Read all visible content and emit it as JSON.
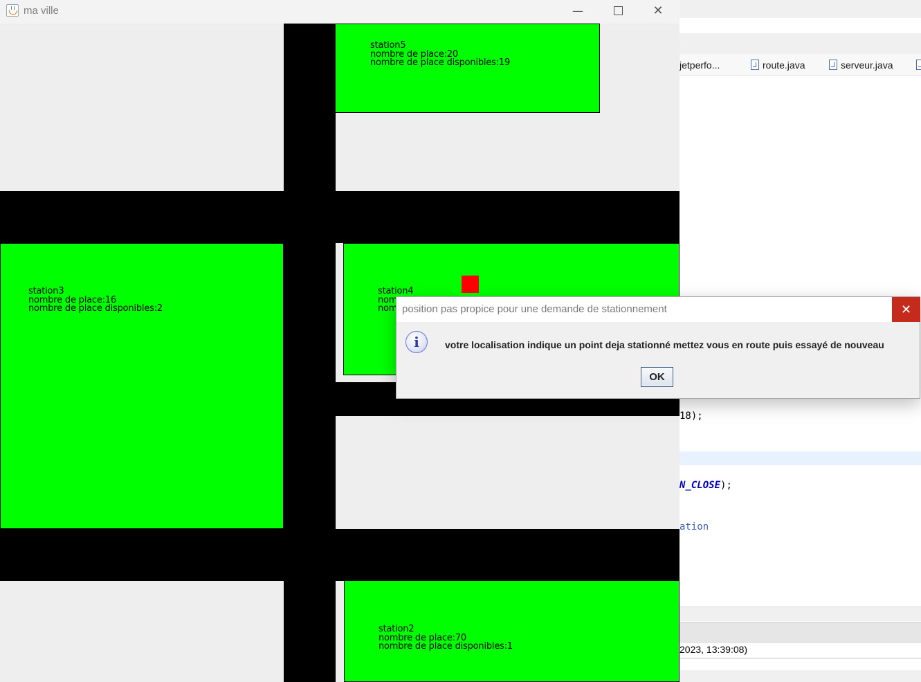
{
  "ide": {
    "tabs": [
      {
        "label": "jetperfo...",
        "icon": "java-file-icon"
      },
      {
        "label": "route.java",
        "icon": "java-file-icon"
      },
      {
        "label": "serveur.java",
        "icon": "java-file-icon"
      }
    ],
    "code": {
      "line1": "18);",
      "line2_keyword": "N_CLOSE",
      "line2_rest": ");",
      "line3": "ation"
    },
    "console_text": "2023, 13:39:08)"
  },
  "window": {
    "title": "ma ville",
    "app_icon": "java-icon",
    "minimize_glyph": "—",
    "close_glyph": "✕"
  },
  "map": {
    "colors": {
      "background": "#eeeeee",
      "road": "#000000",
      "station": "#00ff00",
      "car": "#ff0000"
    },
    "stations": [
      {
        "id": "station5",
        "name": "station5",
        "places": "nombre de place:20",
        "available": "nombre de place disponibles:19"
      },
      {
        "id": "station3",
        "name": "station3",
        "places": "nombre de place:16",
        "available": "nombre de place disponibles:2"
      },
      {
        "id": "station4",
        "name": "station4",
        "places": "nom",
        "available": "nom"
      },
      {
        "id": "station2",
        "name": "station2",
        "places": "nombre de place:70",
        "available": "nombre de place disponibles:1"
      }
    ]
  },
  "dialog": {
    "title": "position pas propice pour une demande de stationnement",
    "close_glyph": "✕",
    "icon": "info-icon",
    "icon_glyph": "i",
    "message": "votre localisation indique un point deja stationné mettez vous en route puis essayé de nouveau",
    "ok_label": "OK"
  }
}
